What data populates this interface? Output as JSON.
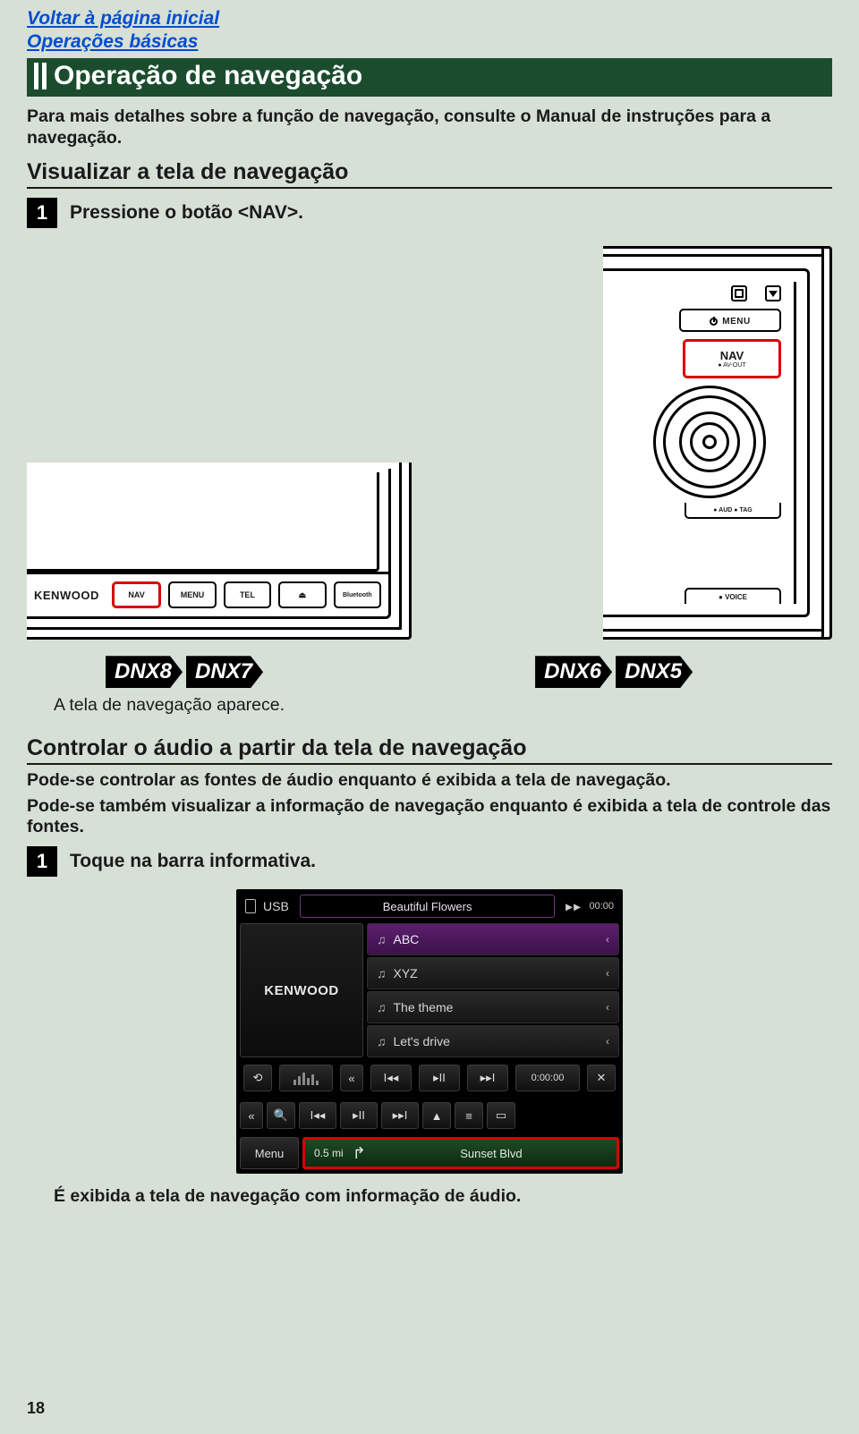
{
  "links": {
    "home": "Voltar à página inicial",
    "basics": "Operações básicas"
  },
  "banner": "Operação de navegação",
  "intro": "Para mais detalhes sobre a função de navegação, consulte o Manual de instruções para a navegação.",
  "h2_a": "Visualizar a tela de navegação",
  "step1": {
    "num": "1",
    "text": "Pressione o botão <NAV>."
  },
  "device_left": {
    "brand": "KENWOOD",
    "buttons": [
      "NAV",
      "MENU",
      "TEL",
      "⏏",
      "Bluetooth"
    ]
  },
  "device_right": {
    "menu": "MENU",
    "nav": "NAV",
    "nav_sub": "● AV-OUT",
    "aud": "● AUD ● TAG",
    "voice": "● VOICE"
  },
  "tags": {
    "l1": "DNX8",
    "l2": "DNX7",
    "r1": "DNX6",
    "r2": "DNX5"
  },
  "result_a": "A tela de navegação aparece.",
  "h2_b": "Controlar o áudio a partir da tela de navegação",
  "p1": "Pode-se controlar as fontes de áudio enquanto é exibida a tela de navegação.",
  "p2": "Pode-se também visualizar a informação de navegação enquanto é exibida a tela de controle das fontes.",
  "step2": {
    "num": "1",
    "text": "Toque na barra informativa."
  },
  "screenshot": {
    "source": "USB",
    "now_playing": "Beautiful Flowers",
    "clock": "00:00",
    "brand": "KENWOOD",
    "tracks": [
      "ABC",
      "XYZ",
      "The theme",
      "Let's drive"
    ],
    "elapsed": "0:00:00",
    "menu": "Menu",
    "distance": "0.5 mi",
    "destination": "Sunset Blvd"
  },
  "final": "É exibida a tela de navegação com informação de áudio.",
  "page_number": "18"
}
